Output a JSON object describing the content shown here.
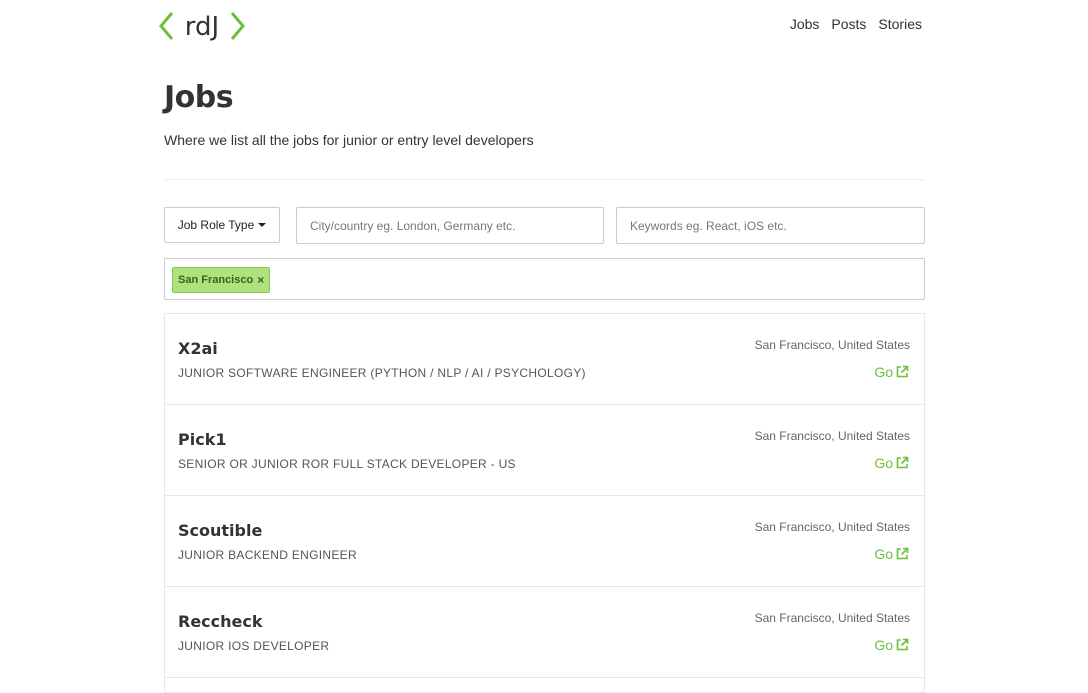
{
  "brand": {
    "logo_text": "rdJ",
    "accent_color": "#6cbf3a"
  },
  "nav": {
    "items": [
      "Jobs",
      "Posts",
      "Stories"
    ]
  },
  "page": {
    "title": "Jobs",
    "subtitle": "Where we list all the jobs for junior or entry level developers"
  },
  "filters": {
    "role_type_label": "Job Role Type",
    "city_placeholder": "City/country eg. London, Germany etc.",
    "city_value": "",
    "keywords_placeholder": "Keywords eg. React, iOS etc.",
    "keywords_value": "",
    "active_tags": [
      {
        "label": "San Francisco",
        "remove": "×"
      }
    ]
  },
  "jobs": [
    {
      "company": "X2ai",
      "role": "JUNIOR SOFTWARE ENGINEER (PYTHON / NLP / AI / PSYCHOLOGY)",
      "location": "San Francisco, United States",
      "action": "Go",
      "action_icon": "external-link-icon"
    },
    {
      "company": "Pick1",
      "role": "SENIOR OR JUNIOR ROR FULL STACK DEVELOPER - US",
      "location": "San Francisco, United States",
      "action": "Go",
      "action_icon": "external-link-icon"
    },
    {
      "company": "Scoutible",
      "role": "JUNIOR BACKEND ENGINEER",
      "location": "San Francisco, United States",
      "action": "Go",
      "action_icon": "external-link-icon"
    },
    {
      "company": "Reccheck",
      "role": "JUNIOR IOS DEVELOPER",
      "location": "San Francisco, United States",
      "action": "Go",
      "action_icon": "external-link-icon"
    }
  ]
}
